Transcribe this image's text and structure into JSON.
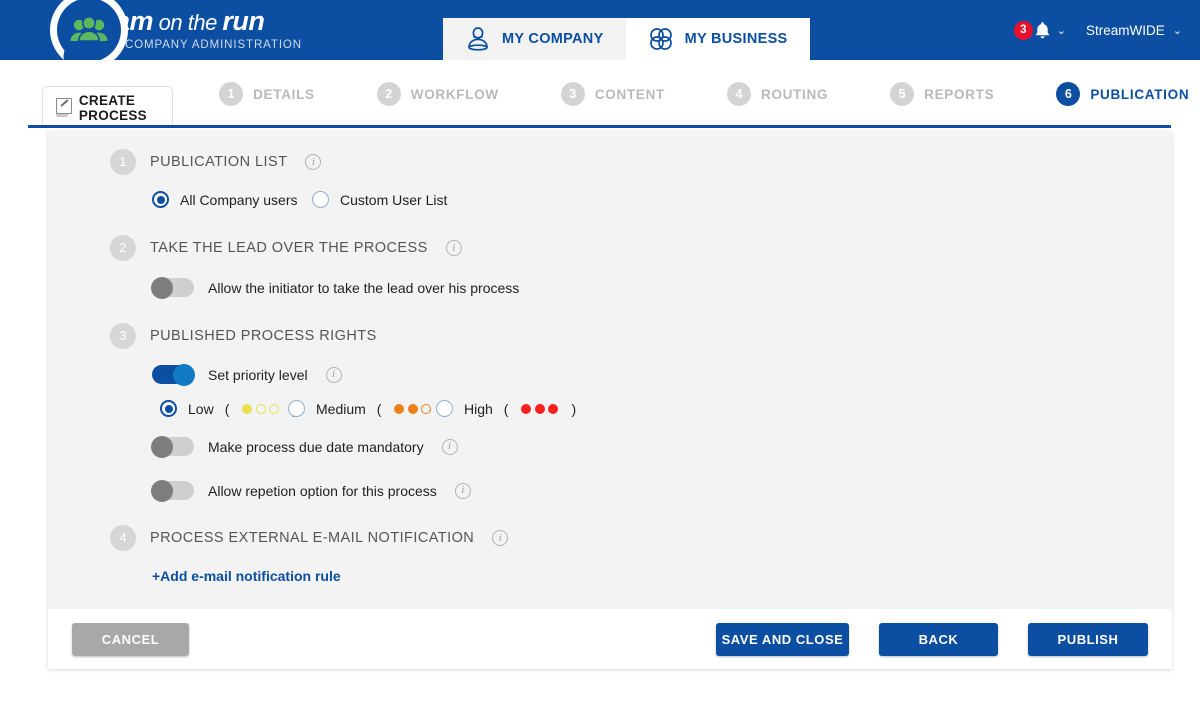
{
  "header": {
    "brand_title_bold1": "team",
    "brand_title_thin": " on the ",
    "brand_title_bold2": "run",
    "brand_subtitle": "WEB COMPANY ADMINISTRATION",
    "logo_icon": "group-users-icon",
    "tabs": [
      {
        "label": "MY COMPANY",
        "icon": "company-people-icon",
        "active": false
      },
      {
        "label": "MY BUSINESS",
        "icon": "business-flower-icon",
        "active": true
      }
    ],
    "notifications": {
      "count": "3",
      "icon": "bell-icon",
      "caret": "⌄"
    },
    "user": {
      "name": "StreamWIDE",
      "caret": "⌄"
    },
    "accent_color": "#0b4ea2",
    "badge_color": "#e8112d"
  },
  "stepbar": {
    "create_chip": {
      "label": "CREATE PROCESS",
      "icon": "pencil-edit-icon"
    },
    "steps": [
      {
        "num": "1",
        "label": "DETAILS",
        "active": false
      },
      {
        "num": "2",
        "label": "WORKFLOW",
        "active": false
      },
      {
        "num": "3",
        "label": "CONTENT",
        "active": false
      },
      {
        "num": "4",
        "label": "ROUTING",
        "active": false
      },
      {
        "num": "5",
        "label": "REPORTS",
        "active": false
      },
      {
        "num": "6",
        "label": "PUBLICATION",
        "active": true
      }
    ]
  },
  "sections": {
    "publication_list": {
      "num": "1",
      "title": "PUBLICATION LIST",
      "info": "i",
      "options": [
        {
          "label": "All Company users",
          "checked": true
        },
        {
          "label": "Custom User List",
          "checked": false
        }
      ]
    },
    "take_lead": {
      "num": "2",
      "title": "TAKE THE LEAD OVER THE PROCESS",
      "info": "i",
      "toggle": {
        "label": "Allow the initiator to take the lead over his process",
        "on": false
      }
    },
    "process_rights": {
      "num": "3",
      "title": "PUBLISHED PROCESS RIGHTS",
      "priority_toggle": {
        "label": "Set priority level",
        "on": true,
        "info": "i"
      },
      "priority_options": [
        {
          "label": "Low",
          "checked": true,
          "color": "#ecdf4f",
          "filled": 1,
          "total": 3
        },
        {
          "label": "Medium",
          "checked": false,
          "color": "#f07f1a",
          "filled": 2,
          "total": 3
        },
        {
          "label": "High",
          "checked": false,
          "color": "#fa2020",
          "filled": 3,
          "total": 3
        }
      ],
      "toggles": [
        {
          "label": "Make process due date mandatory",
          "on": false,
          "info": "i"
        },
        {
          "label": "Allow repetion option for this process",
          "on": false,
          "info": "i"
        }
      ]
    },
    "email_notification": {
      "num": "4",
      "title": "PROCESS EXTERNAL E-MAIL NOTIFICATION",
      "info": "i",
      "add_link": "+Add e-mail notification rule"
    }
  },
  "footer": {
    "cancel": "CANCEL",
    "save_and_close": "SAVE AND CLOSE",
    "back": "BACK",
    "publish": "PUBLISH"
  }
}
